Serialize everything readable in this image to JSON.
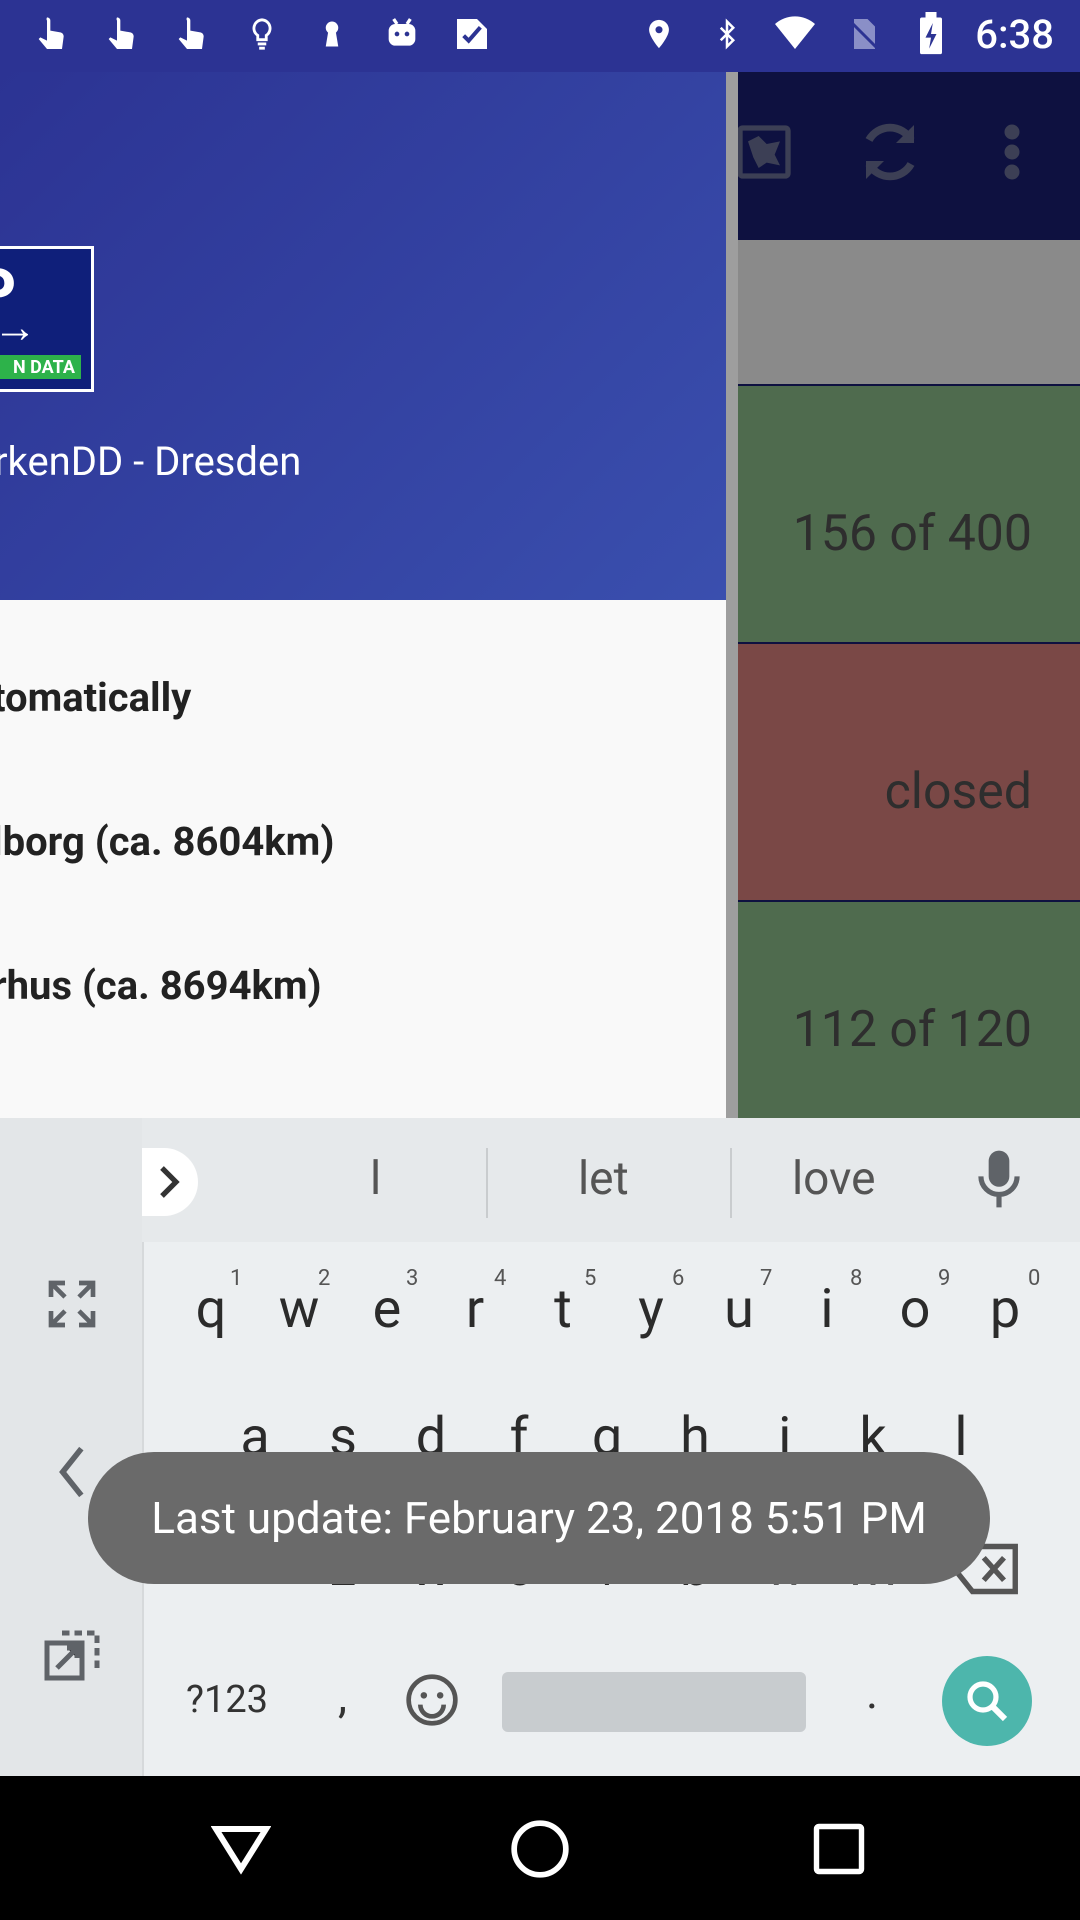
{
  "status_bar": {
    "time": "6:38",
    "icons_left": [
      "touch-icon",
      "touch-icon",
      "touch-icon",
      "bulb-icon",
      "keyhole-icon",
      "android-icon",
      "check-icon"
    ],
    "icons_right": [
      "location-icon",
      "bluetooth-icon",
      "wifi-icon",
      "no-sim-icon",
      "battery-charging-icon"
    ]
  },
  "drawer": {
    "header_title": "rkenDD - Dresden",
    "logo_text": "N DATA",
    "items": [
      {
        "label": "tomatically"
      },
      {
        "label": "lborg (ca. 8604km)"
      },
      {
        "label": "rhus (ca. 8694km)"
      }
    ]
  },
  "app": {
    "rows": [
      "156 of 400",
      "closed",
      "112 of 120"
    ],
    "toolbar_icons": [
      "map-icon",
      "refresh-icon",
      "more-options-icon"
    ]
  },
  "keyboard": {
    "suggestions": [
      "l",
      "let",
      "love"
    ],
    "row1": [
      "q",
      "w",
      "e",
      "r",
      "t",
      "y",
      "u",
      "i",
      "o",
      "p"
    ],
    "row1_numbers": [
      "1",
      "2",
      "3",
      "4",
      "5",
      "6",
      "7",
      "8",
      "9",
      "0"
    ],
    "row2": [
      "a",
      "s",
      "d",
      "f",
      "g",
      "h",
      "j",
      "k",
      "l"
    ],
    "row3": [
      "z",
      "x",
      "c",
      "v",
      "b",
      "n",
      "m"
    ],
    "symbols_label": "?123",
    "comma": ",",
    "period": "."
  },
  "toast": {
    "text": "Last update: February 23, 2018 5:51 PM"
  },
  "colors": {
    "primary": "#2C3393",
    "open": "#4F6B4E",
    "closed": "#7A4846",
    "search_key": "#4DB6AC"
  }
}
